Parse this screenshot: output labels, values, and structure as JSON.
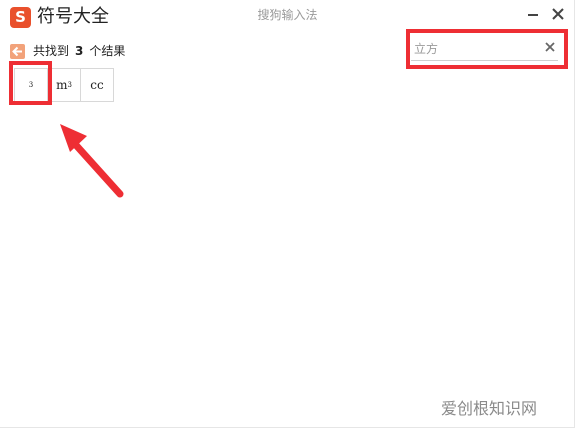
{
  "app": {
    "title": "符号大全",
    "logo_letter": "S",
    "ime_title": "搜狗输入法"
  },
  "window_controls": {
    "minimize_icon": "minimize-icon",
    "close_icon": "close-icon"
  },
  "results": {
    "prefix": "共找到",
    "count": "3",
    "suffix": "个结果"
  },
  "search": {
    "value": "立方",
    "clear_icon": "clear-icon"
  },
  "symbols": [
    {
      "main": "",
      "sup": "3"
    },
    {
      "main": "m",
      "sup": "3"
    },
    {
      "main": "cc",
      "sup": ""
    }
  ],
  "annotation": {
    "color": "#ee2e34"
  },
  "watermark": "爱创根知识网",
  "colors": {
    "brand": "#e9502c",
    "back_icon": "#f2a27a",
    "highlight": "#ee2e34"
  }
}
